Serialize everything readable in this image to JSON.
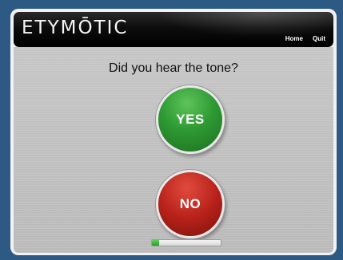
{
  "header": {
    "logo_text": "ETYMŌTIC",
    "nav": {
      "home_label": "Home",
      "quit_label": "Quit"
    }
  },
  "main": {
    "question": "Did you hear the tone?",
    "yes_label": "YES",
    "no_label": "NO",
    "progress_fraction": 0.1
  },
  "colors": {
    "page_background": "#2d5a85",
    "yes_button": "#2e9a33",
    "no_button": "#b8221a",
    "progress_fill": "#3cb83c"
  }
}
